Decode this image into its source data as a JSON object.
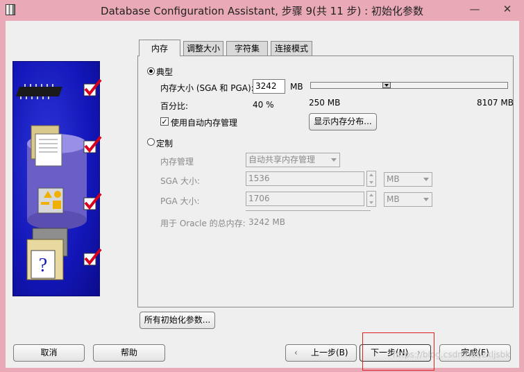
{
  "window": {
    "title": "Database Configuration Assistant, 步骤 9(共 11 步) : 初始化参数",
    "minimize": "—",
    "close": "✕"
  },
  "tabs": [
    {
      "label": "内存",
      "active": true
    },
    {
      "label": "调整大小",
      "active": false
    },
    {
      "label": "字符集",
      "active": false
    },
    {
      "label": "连接模式",
      "active": false
    }
  ],
  "typical": {
    "radio_label": "典型",
    "selected": true,
    "memory_size_label": "内存大小 (SGA 和 PGA):",
    "memory_size_value": "3242",
    "memory_unit": "MB",
    "percent_label": "百分比:",
    "percent_value": "40 %",
    "slider_min": "250 MB",
    "slider_max": "8107 MB",
    "slider_fraction": 0.38,
    "amm_label": "使用自动内存管理",
    "amm_checked": true,
    "show_distribution_button": "显示内存分布..."
  },
  "custom": {
    "radio_label": "定制",
    "selected": false,
    "memory_mgmt_label": "内存管理",
    "memory_mgmt_value": "自动共享内存管理",
    "sga_label": "SGA 大小:",
    "sga_value": "1536",
    "sga_unit": "MB",
    "pga_label": "PGA 大小:",
    "pga_value": "1706",
    "pga_unit": "MB",
    "total_label": "用于 Oracle 的总内存:",
    "total_value": "3242 MB"
  },
  "all_params_button": "所有初始化参数...",
  "footer": {
    "cancel": "取消",
    "help": "帮助",
    "back": "上一步(B)",
    "next": "下一步(N)",
    "finish": "完成(F)"
  },
  "watermark": "https://blog.csdn.net/zxljsbk",
  "colors": {
    "title_bar": "#e9a9b6",
    "side_panel": "#1316b8",
    "highlight": "#e02020"
  }
}
